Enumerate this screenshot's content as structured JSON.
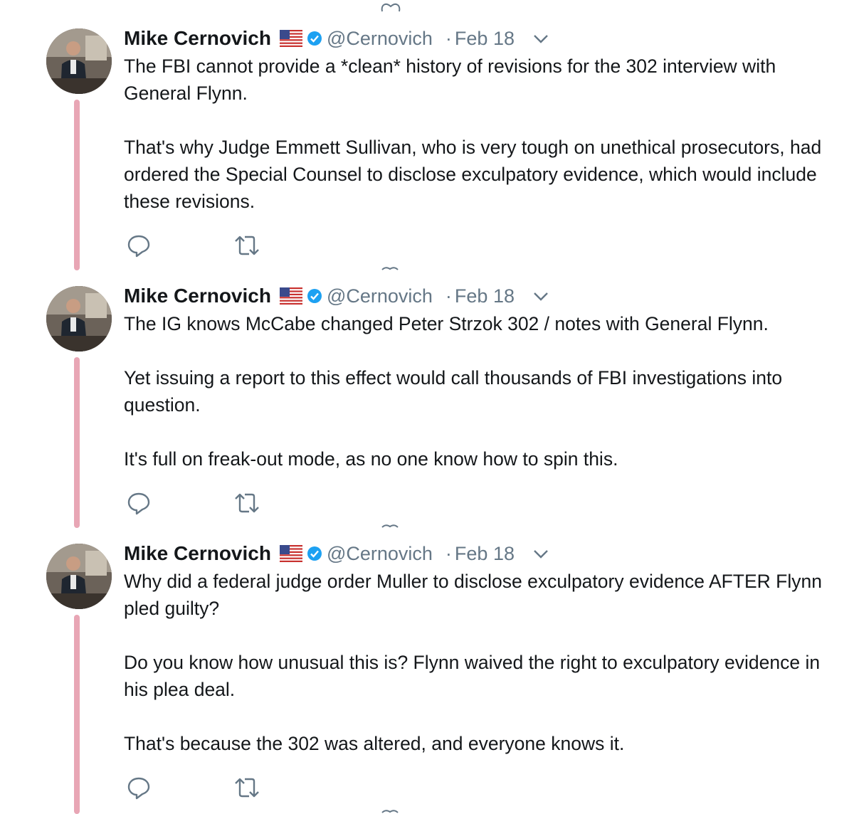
{
  "colors": {
    "text": "#14171a",
    "secondary": "#657786",
    "thread_line": "#e8a6b5",
    "verified_blue": "#1da1f2"
  },
  "icons": {
    "reply": "reply-icon",
    "retweet": "retweet-icon",
    "more": "chevron-down-icon",
    "verified": "verified-badge-icon",
    "flag": "us-flag-icon",
    "like": "heart-icon"
  },
  "tweets": [
    {
      "name": "Mike Cernovich",
      "handle": "@Cernovich",
      "separator": "·",
      "date": "Feb 18",
      "paragraphs": [
        "The FBI cannot provide a *clean* history of revisions for the 302 interview with General Flynn.",
        "That's why Judge Emmett Sullivan, who is very tough on unethical prosecutors, had ordered the Special Counsel to disclose exculpatory evidence, which would include these revisions."
      ]
    },
    {
      "name": "Mike Cernovich",
      "handle": "@Cernovich",
      "separator": "·",
      "date": "Feb 18",
      "paragraphs": [
        "The IG knows McCabe changed Peter Strzok 302 / notes with General Flynn.",
        "Yet issuing a report to this effect would call thousands of FBI investigations into question.",
        "It's full on freak-out mode, as no one know how to spin this."
      ]
    },
    {
      "name": "Mike Cernovich",
      "handle": "@Cernovich",
      "separator": "·",
      "date": "Feb 18",
      "paragraphs": [
        "Why did a federal judge order Muller to disclose exculpatory evidence AFTER Flynn pled guilty?",
        "Do you know how unusual this is? Flynn waived the right to exculpatory evidence in his plea deal.",
        "That's because the 302 was altered, and everyone knows it."
      ]
    }
  ]
}
